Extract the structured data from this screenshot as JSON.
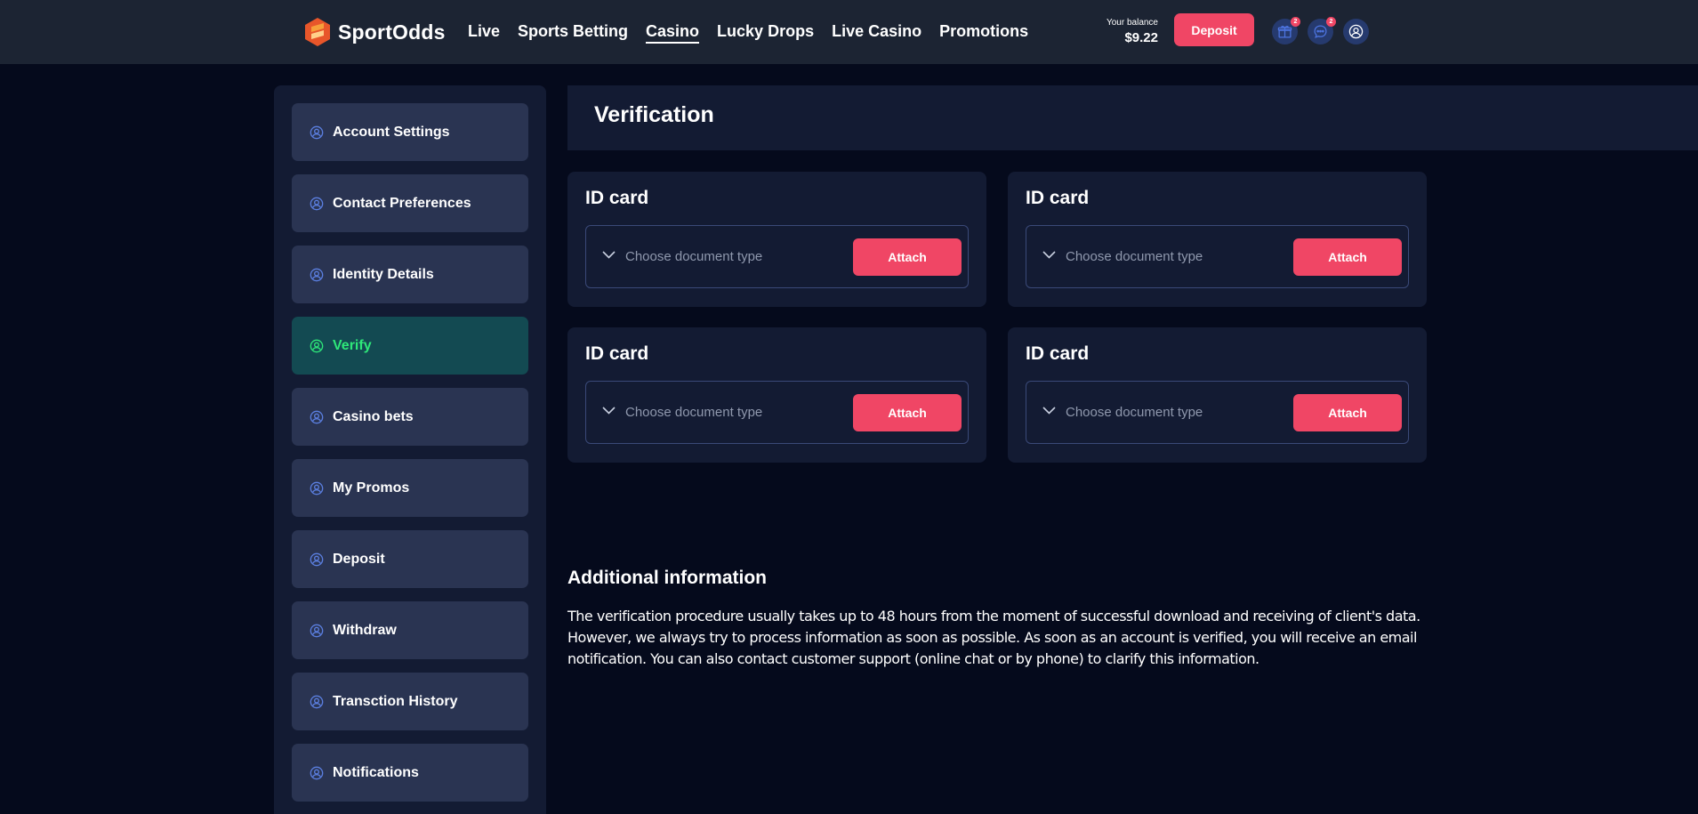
{
  "header": {
    "brand": "SportOdds",
    "nav": [
      {
        "label": "Live",
        "active": false
      },
      {
        "label": "Sports Betting",
        "active": false
      },
      {
        "label": "Casino",
        "active": true
      },
      {
        "label": "Lucky Drops",
        "active": false
      },
      {
        "label": "Live Casino",
        "active": false
      },
      {
        "label": "Promotions",
        "active": false
      }
    ],
    "balance_label": "Your balance",
    "balance_value": "$9.22",
    "deposit_label": "Deposit",
    "gift_count": "2",
    "chat_count": "2"
  },
  "sidebar": {
    "items": [
      {
        "label": "Account Settings",
        "active": false
      },
      {
        "label": "Contact Preferences",
        "active": false
      },
      {
        "label": "Identity Details",
        "active": false
      },
      {
        "label": "Verify",
        "active": true
      },
      {
        "label": "Casino bets",
        "active": false
      },
      {
        "label": "My Promos",
        "active": false
      },
      {
        "label": "Deposit",
        "active": false
      },
      {
        "label": "Withdraw",
        "active": false
      },
      {
        "label": "Transction History",
        "active": false
      },
      {
        "label": "Notifications",
        "active": false
      }
    ]
  },
  "main": {
    "title": "Verification",
    "cards": [
      {
        "title": "ID card",
        "placeholder": "Choose document type",
        "button": "Attach"
      },
      {
        "title": "ID card",
        "placeholder": "Choose document type",
        "button": "Attach"
      },
      {
        "title": "ID card",
        "placeholder": "Choose document type",
        "button": "Attach"
      },
      {
        "title": "ID card",
        "placeholder": "Choose document type",
        "button": "Attach"
      }
    ],
    "info_heading": "Additional information",
    "info_text": "The verification procedure usually takes up to 48 hours from the moment of successful download and receiving of client's data. However, we always try to process information as soon as possible. As soon as an account is verified, you will receive an email notification. You can also contact customer support (online chat or by phone) to clarify this information."
  },
  "colors": {
    "accent": "#f04665",
    "active_text": "#2ee879",
    "active_bg": "#134a52",
    "background": "#050a1c",
    "panel": "#131b33"
  },
  "icons": {
    "logo": "sportodds-logo-icon",
    "gift": "gift-icon",
    "chat": "chat-icon",
    "profile": "user-circle-icon",
    "sidebar_item": "user-circle-icon",
    "dropdown": "chevron-down-icon"
  }
}
